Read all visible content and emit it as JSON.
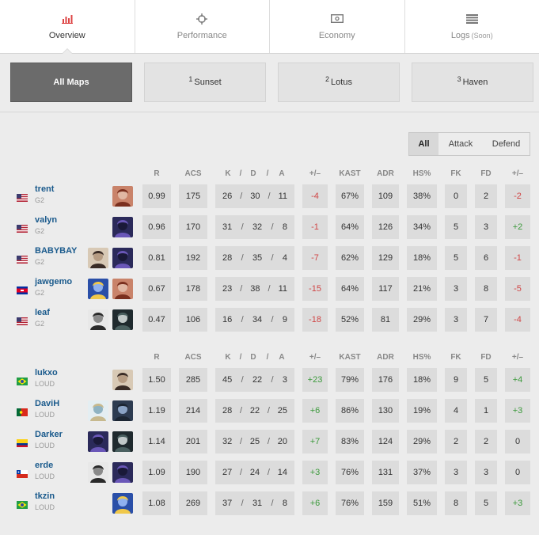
{
  "tabs": [
    {
      "label": "Overview",
      "icon": "bar-chart-icon",
      "active": true
    },
    {
      "label": "Performance",
      "icon": "crosshair-icon",
      "active": false
    },
    {
      "label": "Economy",
      "icon": "banknote-icon",
      "active": false
    },
    {
      "label": "Logs",
      "soon": "(Soon)",
      "icon": "list-icon",
      "active": false
    }
  ],
  "maps": [
    {
      "num": "",
      "label": "All Maps",
      "active": true
    },
    {
      "num": "1",
      "label": "Sunset",
      "active": false
    },
    {
      "num": "2",
      "label": "Lotus",
      "active": false
    },
    {
      "num": "3",
      "label": "Haven",
      "active": false
    }
  ],
  "sides": [
    "All",
    "Attack",
    "Defend"
  ],
  "columns": [
    "R",
    "ACS",
    "K",
    "/",
    "D",
    "/",
    "A",
    "+/–",
    "KAST",
    "ADR",
    "HS%",
    "FK",
    "FD",
    "+/–"
  ],
  "colors": {
    "positive": "#3c9a3c",
    "negative": "#d04545",
    "link": "#1a5a8c"
  },
  "teams": [
    {
      "name": "G2",
      "players": [
        {
          "name": "trent",
          "team": "G2",
          "flag": "us",
          "agents": [
            "kayo"
          ],
          "r": "0.99",
          "acs": "175",
          "k": "26",
          "d": "30",
          "a": "11",
          "kd": "-4",
          "kast": "67%",
          "adr": "109",
          "hs": "38%",
          "fk": "0",
          "fd": "2",
          "fkd": "-2"
        },
        {
          "name": "valyn",
          "team": "G2",
          "flag": "us",
          "agents": [
            "omen"
          ],
          "r": "0.96",
          "acs": "170",
          "k": "31",
          "d": "32",
          "a": "8",
          "kd": "-1",
          "kast": "64%",
          "adr": "126",
          "hs": "34%",
          "fk": "5",
          "fd": "3",
          "fkd": "+2"
        },
        {
          "name": "BABYBAY",
          "team": "G2",
          "flag": "us",
          "agents": [
            "chamber",
            "omen"
          ],
          "r": "0.81",
          "acs": "192",
          "k": "28",
          "d": "35",
          "a": "4",
          "kd": "-7",
          "kast": "62%",
          "adr": "129",
          "hs": "18%",
          "fk": "5",
          "fd": "6",
          "fkd": "-1"
        },
        {
          "name": "jawgemo",
          "team": "G2",
          "flag": "kh",
          "agents": [
            "neon",
            "kayo"
          ],
          "r": "0.67",
          "acs": "178",
          "k": "23",
          "d": "38",
          "a": "11",
          "kd": "-15",
          "kast": "64%",
          "adr": "117",
          "hs": "21%",
          "fk": "3",
          "fd": "8",
          "fkd": "-5"
        },
        {
          "name": "leaf",
          "team": "G2",
          "flag": "us",
          "agents": [
            "fade",
            "viper"
          ],
          "r": "0.47",
          "acs": "106",
          "k": "16",
          "d": "34",
          "a": "9",
          "kd": "-18",
          "kast": "52%",
          "adr": "81",
          "hs": "29%",
          "fk": "3",
          "fd": "7",
          "fkd": "-4"
        }
      ]
    },
    {
      "name": "LOUD",
      "players": [
        {
          "name": "lukxo",
          "team": "LOUD",
          "flag": "br",
          "agents": [
            "chamber"
          ],
          "r": "1.50",
          "acs": "285",
          "k": "45",
          "d": "22",
          "a": "3",
          "kd": "+23",
          "kast": "79%",
          "adr": "176",
          "hs": "18%",
          "fk": "9",
          "fd": "5",
          "fkd": "+4"
        },
        {
          "name": "DaviH",
          "team": "LOUD",
          "flag": "pt",
          "agents": [
            "sage",
            "harbor"
          ],
          "r": "1.19",
          "acs": "214",
          "k": "28",
          "d": "22",
          "a": "25",
          "kd": "+6",
          "kast": "86%",
          "adr": "130",
          "hs": "19%",
          "fk": "4",
          "fd": "1",
          "fkd": "+3"
        },
        {
          "name": "Darker",
          "team": "LOUD",
          "flag": "co",
          "agents": [
            "omen",
            "viper"
          ],
          "r": "1.14",
          "acs": "201",
          "k": "32",
          "d": "25",
          "a": "20",
          "kd": "+7",
          "kast": "83%",
          "adr": "124",
          "hs": "29%",
          "fk": "2",
          "fd": "2",
          "fkd": "0"
        },
        {
          "name": "erde",
          "team": "LOUD",
          "flag": "cl",
          "agents": [
            "fade",
            "omen"
          ],
          "r": "1.09",
          "acs": "190",
          "k": "27",
          "d": "24",
          "a": "14",
          "kd": "+3",
          "kast": "76%",
          "adr": "131",
          "hs": "37%",
          "fk": "3",
          "fd": "3",
          "fkd": "0"
        },
        {
          "name": "tkzin",
          "team": "LOUD",
          "flag": "br",
          "agents": [
            "neon"
          ],
          "r": "1.08",
          "acs": "269",
          "k": "37",
          "d": "31",
          "a": "8",
          "kd": "+6",
          "kast": "76%",
          "adr": "159",
          "hs": "51%",
          "fk": "8",
          "fd": "5",
          "fkd": "+3"
        }
      ]
    }
  ]
}
